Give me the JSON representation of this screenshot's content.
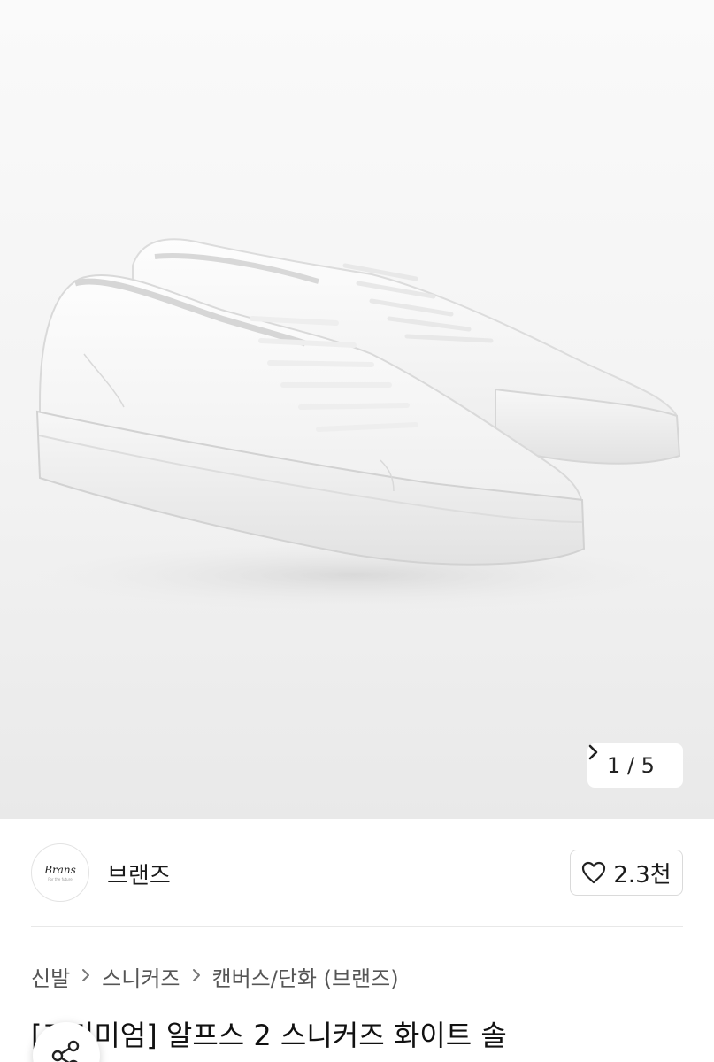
{
  "gallery": {
    "image_alt": "white leather low-top sneakers",
    "counter": "1 / 5",
    "next_icon": "chevron-right-icon"
  },
  "seller": {
    "avatar_logo": "Brans",
    "avatar_sub": "For the future",
    "name": "브랜즈",
    "like_icon": "heart-outline-icon",
    "like_count": "2.3천"
  },
  "breadcrumb": {
    "items": [
      "신발",
      "스니커즈",
      "캔버스/단화 (브랜즈)"
    ],
    "separator": ">"
  },
  "product": {
    "title": "[프리미엄] 알프스 2 스니커즈 화이트 솔"
  },
  "share": {
    "icon": "share-icon"
  }
}
